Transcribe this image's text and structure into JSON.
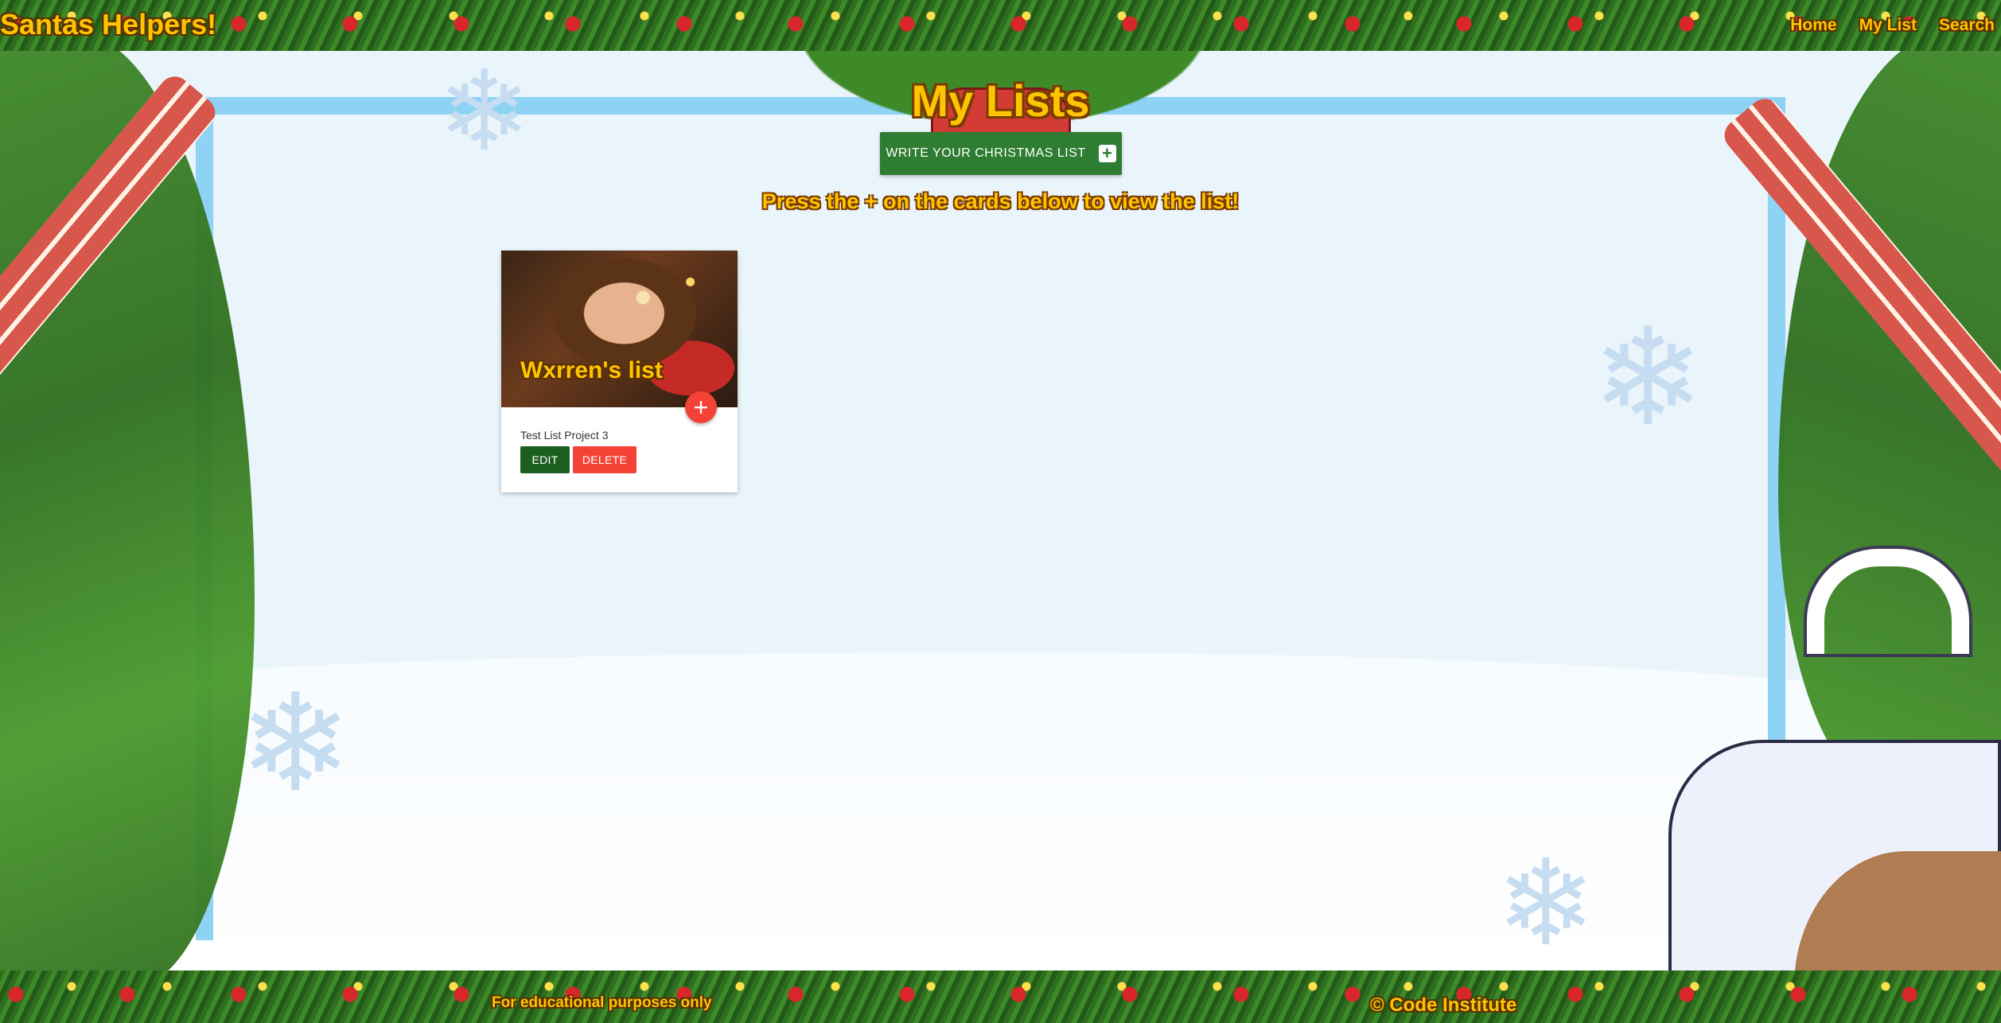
{
  "header": {
    "brand": "Santas Helpers!",
    "nav": [
      "Home",
      "My List",
      "Search"
    ]
  },
  "main": {
    "title": "My Lists",
    "write_button_label": "WRITE YOUR CHRISTMAS LIST",
    "write_button_icon": "plus-square-icon",
    "instruction": "Press the + on the cards below to view the list!"
  },
  "lists": [
    {
      "title": "Wxrren's list",
      "description": "Test List Project 3",
      "image": "child-with-gift-photo",
      "view_icon": "plus-icon",
      "edit_label": "EDIT",
      "delete_label": "DELETE"
    }
  ],
  "footer": {
    "left_text": "For educational purposes only",
    "right_text": "© Code Institute"
  },
  "colors": {
    "gold_text": "#ffc400",
    "primary_green": "#2e7d32",
    "edit_green": "#1b5e20",
    "danger_red": "#f44336",
    "frame_blue": "#8ed2f4"
  }
}
